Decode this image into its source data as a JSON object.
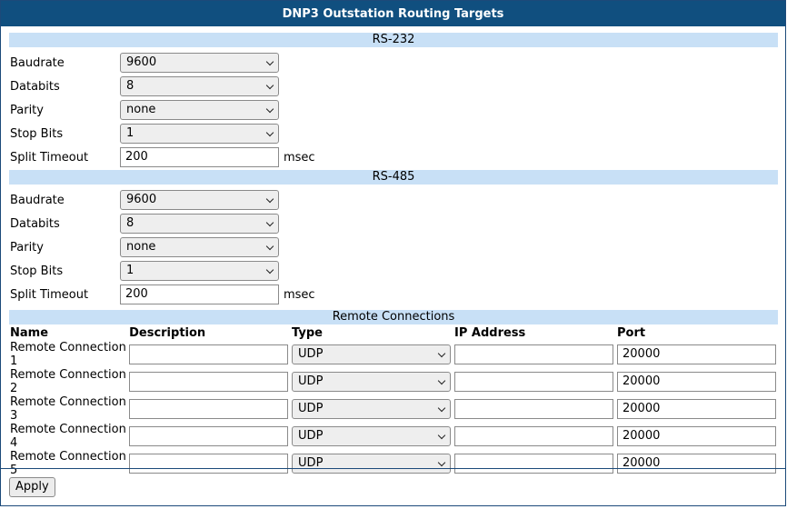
{
  "title": "DNP3 Outstation Routing Targets",
  "rs232": {
    "heading": "RS-232",
    "baudrate_label": "Baudrate",
    "baudrate": "9600",
    "databits_label": "Databits",
    "databits": "8",
    "parity_label": "Parity",
    "parity": "none",
    "stopbits_label": "Stop Bits",
    "stopbits": "1",
    "split_label": "Split Timeout",
    "split": "200",
    "split_unit": "msec"
  },
  "rs485": {
    "heading": "RS-485",
    "baudrate_label": "Baudrate",
    "baudrate": "9600",
    "databits_label": "Databits",
    "databits": "8",
    "parity_label": "Parity",
    "parity": "none",
    "stopbits_label": "Stop Bits",
    "stopbits": "1",
    "split_label": "Split Timeout",
    "split": "200",
    "split_unit": "msec"
  },
  "remote": {
    "heading": "Remote Connections",
    "columns": [
      "Name",
      "Description",
      "Type",
      "IP Address",
      "Port"
    ],
    "rows": [
      {
        "name": "Remote Connection 1",
        "description": "",
        "type": "UDP",
        "ip": "",
        "port": "20000"
      },
      {
        "name": "Remote Connection 2",
        "description": "",
        "type": "UDP",
        "ip": "",
        "port": "20000"
      },
      {
        "name": "Remote Connection 3",
        "description": "",
        "type": "UDP",
        "ip": "",
        "port": "20000"
      },
      {
        "name": "Remote Connection 4",
        "description": "",
        "type": "UDP",
        "ip": "",
        "port": "20000"
      },
      {
        "name": "Remote Connection 5",
        "description": "",
        "type": "UDP",
        "ip": "",
        "port": "20000"
      }
    ]
  },
  "apply_label": "Apply"
}
